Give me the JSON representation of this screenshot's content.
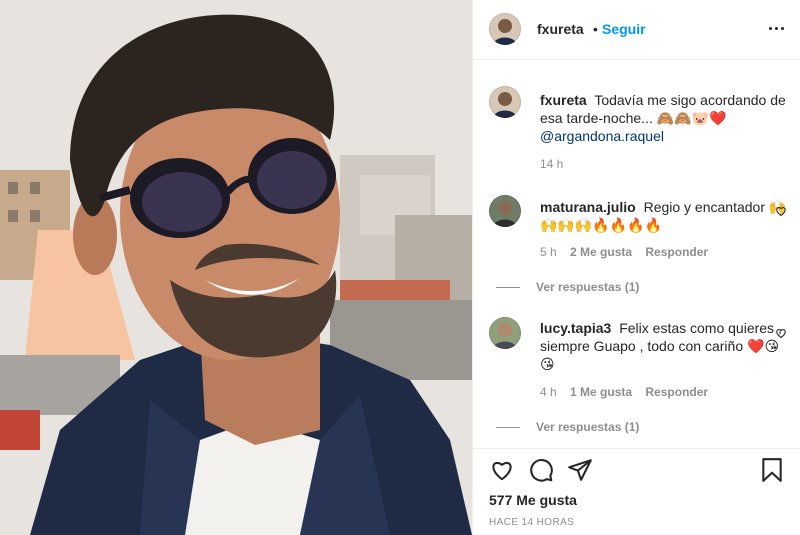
{
  "header": {
    "username": "fxureta",
    "separator": "•",
    "follow_label": "Seguir",
    "more_icon": "more-options-icon"
  },
  "caption": {
    "username": "fxureta",
    "text": "Todavía me sigo acordando de esa tarde-noche... 🙈🙈🐷❤️",
    "mention": "@argandona.raquel",
    "time": "14 h"
  },
  "comments": [
    {
      "username": "maturana.julio",
      "text": "Regio y encantador 🙌🙌🙌🙌🔥🔥🔥🔥",
      "time": "5 h",
      "likes": "2 Me gusta",
      "reply_label": "Responder",
      "view_replies": "Ver respuestas (1)"
    },
    {
      "username": "lucy.tapia3",
      "text": "Felix estas como quieres , siempre Guapo , todo con cariño ❤️😘😘",
      "time": "4 h",
      "likes": "1 Me gusta",
      "reply_label": "Responder",
      "view_replies": "Ver respuestas (1)"
    }
  ],
  "actions": {
    "icons": [
      "heart-icon",
      "comment-icon",
      "share-icon",
      "save-icon"
    ],
    "likes_count": "577 Me gusta",
    "post_time": "Hace 14 horas"
  },
  "colors": {
    "accent": "#0095f6",
    "mention": "#00376b",
    "muted": "#8e8e8e",
    "text": "#262626"
  }
}
